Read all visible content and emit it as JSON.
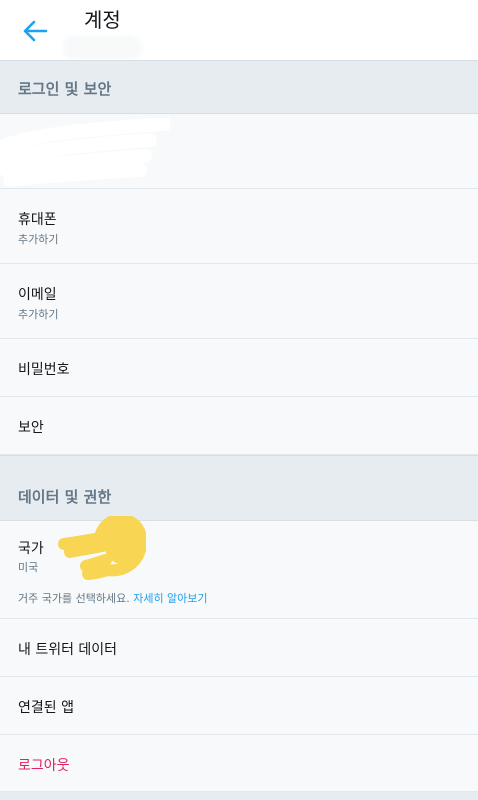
{
  "header": {
    "title": "계정",
    "back_icon": "arrow-left-icon",
    "accent_color": "#1da1f2"
  },
  "sections": {
    "login_security": {
      "title": "로그인 및 보안",
      "phone": {
        "label": "휴대폰",
        "value": "추가하기"
      },
      "email": {
        "label": "이메일",
        "value": "추가하기"
      },
      "password": {
        "label": "비밀번호"
      },
      "security": {
        "label": "보안"
      }
    },
    "data_permissions": {
      "title": "데이터 및 권한",
      "country": {
        "label": "국가",
        "value": "미국",
        "hint": "거주 국가를 선택하세요.",
        "hint_link": "자세히 알아보기"
      },
      "twitter_data": {
        "label": "내 트위터 데이터"
      },
      "connected_apps": {
        "label": "연결된 앱"
      },
      "logout": {
        "label": "로그아웃",
        "color": "#e0245e"
      }
    }
  }
}
